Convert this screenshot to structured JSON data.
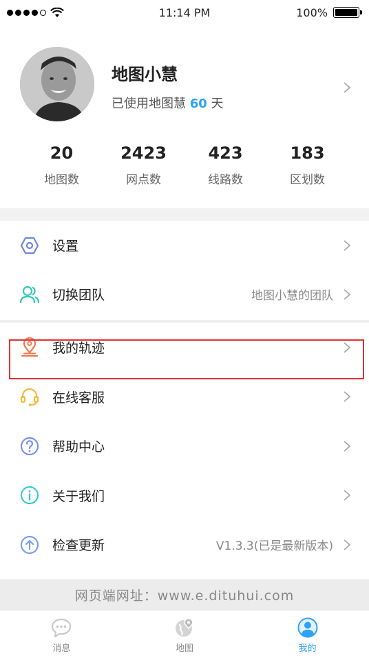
{
  "status_bar": {
    "time": "11:14 PM",
    "battery": "100%",
    "battery_level": 1.0
  },
  "profile": {
    "name": "地图小慧",
    "days_prefix": "已使用地图慧",
    "days_value": "60",
    "days_suffix": "天"
  },
  "stats": [
    {
      "value": "20",
      "label": "地图数"
    },
    {
      "value": "2423",
      "label": "网点数"
    },
    {
      "value": "423",
      "label": "线路数"
    },
    {
      "value": "183",
      "label": "区划数"
    }
  ],
  "menu": {
    "settings": {
      "label": "设置",
      "icon": "gear-hexagon-icon"
    },
    "switch_team": {
      "label": "切换团队",
      "value": "地图小慧的团队",
      "icon": "team-users-icon"
    },
    "my_track": {
      "label": "我的轨迹",
      "icon": "location-pin-icon"
    },
    "online_service": {
      "label": "在线客服",
      "icon": "headset-icon"
    },
    "help_center": {
      "label": "帮助中心",
      "icon": "question-icon"
    },
    "about_us": {
      "label": "关于我们",
      "icon": "info-icon"
    },
    "check_update": {
      "label": "检查更新",
      "value": "V1.3.3(已是最新版本)",
      "icon": "upload-arrow-icon"
    }
  },
  "web_address": "网页端网址：www.e.dituhui.com",
  "tabs": [
    {
      "label": "消息",
      "icon": "chat-bubble-icon",
      "active": false
    },
    {
      "label": "地图",
      "icon": "globe-pin-icon",
      "active": false
    },
    {
      "label": "我的",
      "icon": "user-circle-icon",
      "active": true
    }
  ],
  "colors": {
    "accent_blue": "#2ea1f8",
    "highlight_red": "#e3312f",
    "settings_icon": "#6b87e0",
    "team_icon": "#33c7b8",
    "track_icon": "#f07a4f",
    "service_icon": "#f5b93a",
    "help_icon": "#7a8ff0",
    "about_icon": "#38c9d6",
    "update_icon": "#7a9ff0"
  }
}
